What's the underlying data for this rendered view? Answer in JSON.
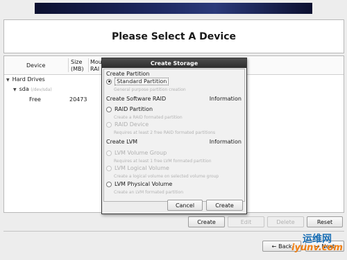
{
  "header": {
    "title": "Please Select A Device"
  },
  "table": {
    "columns": {
      "device": "Device",
      "size": "Size\n(MB)",
      "mount": "Mou\nRAI"
    },
    "rows": {
      "hard_drives": "Hard Drives",
      "sda": "sda",
      "sda_path": "(/dev/sda)",
      "free": "Free",
      "free_size": "20473"
    }
  },
  "bottom_buttons": {
    "create": "Create",
    "edit": "Edit",
    "delete": "Delete",
    "reset": "Reset"
  },
  "nav_buttons": {
    "back": "Back",
    "next": "Next"
  },
  "dialog": {
    "title": "Create Storage",
    "create_partition": "Create Partition",
    "standard_partition": "Standard Partition",
    "standard_partition_desc": "General purpose partition creation",
    "create_software_raid": "Create Software RAID",
    "information": "Information",
    "raid_partition": "RAID Partition",
    "raid_partition_desc": "Create a RAID formated partition",
    "raid_device": "RAID Device",
    "raid_device_desc": "Requires at least 2 free RAID formated partitions",
    "create_lvm": "Create LVM",
    "lvm_volume_group": "LVM Volume Group",
    "lvm_volume_group_desc": "Requires at least 1 free LVM formated partition",
    "lvm_logical_volume": "LVM Logical Volume",
    "lvm_logical_volume_desc": "Create a logical volume on selected volume group",
    "lvm_physical_volume": "LVM Physical Volume",
    "lvm_physical_volume_desc": "Create an LVM formated partition",
    "cancel": "Cancel",
    "create": "Create"
  },
  "watermark": {
    "cn": "运维网",
    "en": "iyunv.com"
  },
  "colors": {
    "banner": "#1f2a63",
    "dialog_title_bg": "#3a3a3a",
    "watermark_blue": "#1a6fb5",
    "watermark_orange": "#f07f12"
  }
}
